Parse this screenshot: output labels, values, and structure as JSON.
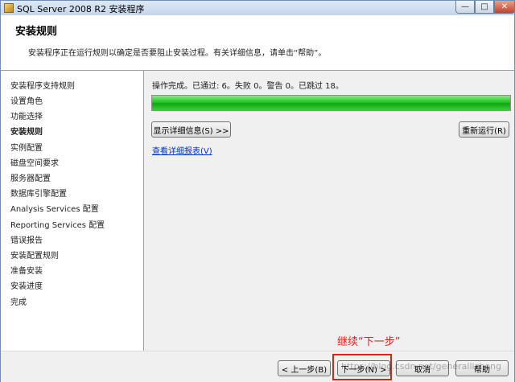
{
  "window": {
    "title": "SQL Server 2008 R2 安装程序",
    "min_symbol": "—",
    "max_symbol": "□",
    "close_symbol": "✕"
  },
  "header": {
    "title": "安装规则",
    "description": "安装程序正在运行规则以确定是否要阻止安装过程。有关详细信息，请单击“帮助”。"
  },
  "sidebar": {
    "items": [
      {
        "label": "安装程序支持规则"
      },
      {
        "label": "设置角色"
      },
      {
        "label": "功能选择"
      },
      {
        "label": "安装规则",
        "active": true
      },
      {
        "label": "实例配置"
      },
      {
        "label": "磁盘空间要求"
      },
      {
        "label": "服务器配置"
      },
      {
        "label": "数据库引擎配置"
      },
      {
        "label": "Analysis Services 配置"
      },
      {
        "label": "Reporting Services 配置"
      },
      {
        "label": "错误报告"
      },
      {
        "label": "安装配置规则"
      },
      {
        "label": "准备安装"
      },
      {
        "label": "安装进度"
      },
      {
        "label": "完成"
      }
    ]
  },
  "main": {
    "status_text": "操作完成。已通过: 6。失败 0。警告 0。已跳过 18。",
    "progress": 1.0,
    "show_details_label": "显示详细信息(S) >>",
    "rerun_label": "重新运行(R)",
    "view_report_label": "查看详细报表(V)"
  },
  "footer": {
    "back_label": "< 上一步(B)",
    "next_label": "下一步(N) >",
    "cancel_label": "取消",
    "help_label": "帮助"
  },
  "annotation": {
    "text": "继续“下一步”",
    "color": "#e0201b"
  },
  "watermark": {
    "text": "https://blog.csdn.net/generallizhong"
  },
  "colors": {
    "progress": "#1fbf1f",
    "link": "#0033cc",
    "accent": "#e0201b"
  }
}
